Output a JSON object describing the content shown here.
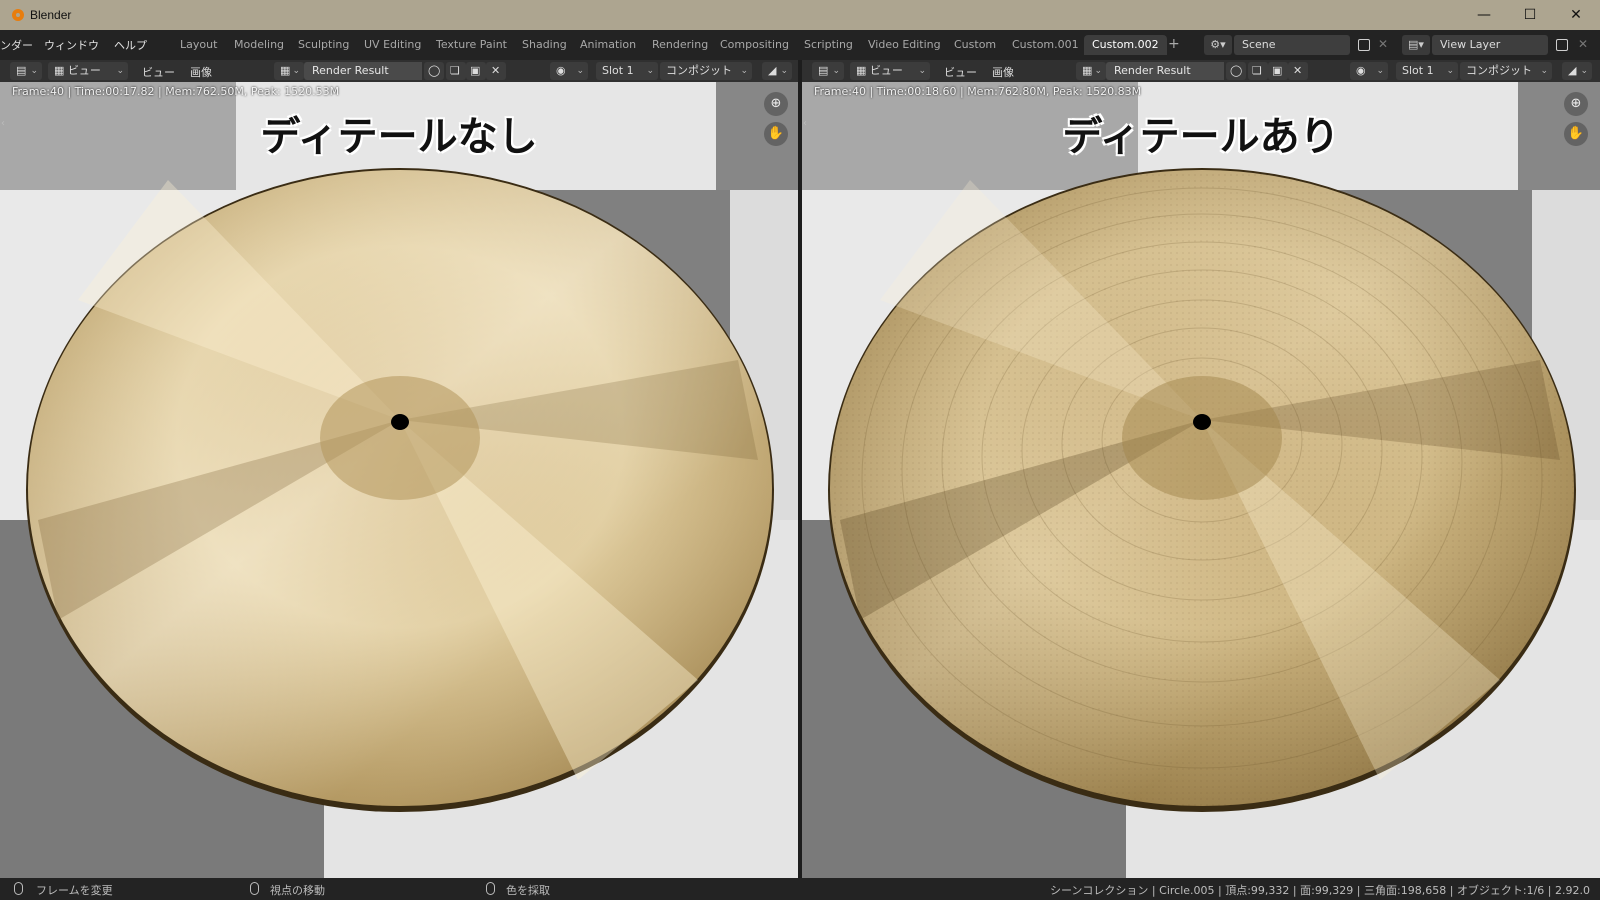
{
  "window": {
    "app_name": "Blender"
  },
  "menu": {
    "render": "ンダー",
    "window": "ウィンドウ",
    "help": "ヘルプ"
  },
  "workspaces": [
    "Layout",
    "Modeling",
    "Sculpting",
    "UV Editing",
    "Texture Paint",
    "Shading",
    "Animation",
    "Rendering",
    "Compositing",
    "Scripting",
    "Video Editing",
    "Custom",
    "Custom.001",
    "Custom.002"
  ],
  "active_workspace": "Custom.002",
  "scene": {
    "name": "Scene",
    "view_layer": "View Layer"
  },
  "left_editor": {
    "view_menu": "ビュー",
    "view_label": "ビュー",
    "image_label": "画像",
    "image_name": "Render Result",
    "slot": "Slot 1",
    "pass": "コンポジット",
    "stats": "Frame:40 | Time:00:17.82 | Mem:762.50M, Peak: 1520.53M",
    "caption": "ディテールなし"
  },
  "right_editor": {
    "view_menu": "ビュー",
    "view_label": "ビュー",
    "image_label": "画像",
    "image_name": "Render Result",
    "slot": "Slot 1",
    "pass": "コンポジット",
    "stats": "Frame:40 | Time:00:18.60 | Mem:762.80M, Peak: 1520.83M",
    "caption": "ディテールあり"
  },
  "statusbar": {
    "hint1": "フレームを変更",
    "hint2": "視点の移動",
    "hint3": "色を採取",
    "info": "シーンコレクション | Circle.005 | 頂点:99,332 | 面:99,329 | 三角面:198,658 | オブジェクト:1/6 | 2.92.0"
  },
  "colors": {
    "accent": "#e87d0d",
    "titlebar": "#ada590",
    "bronze_light": "#f5ecd2",
    "bronze_dark": "#8a6f3a"
  }
}
